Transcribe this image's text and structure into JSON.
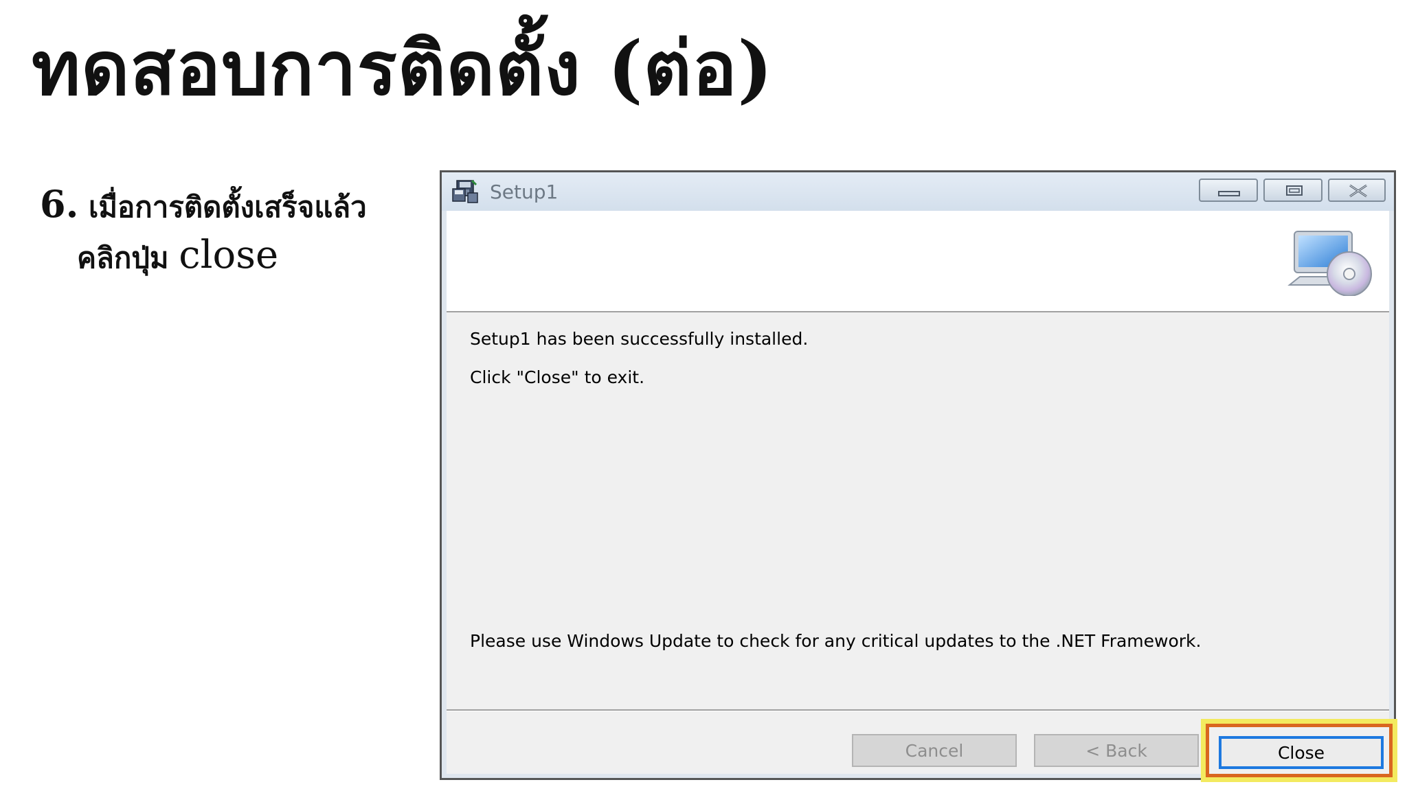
{
  "slide": {
    "title": "ทดสอบการติดตั้ง (ต่อ)",
    "step_number": "6.",
    "step_line1": "เมื่อการติดตั้งเสร็จแล้ว",
    "step_line2_thai": "คลิกปุ่ม",
    "step_line2_en": "close"
  },
  "window": {
    "title": "Setup1",
    "app_icon": "installer-floppy-icon",
    "controls": {
      "minimize_icon": "minimize-icon",
      "maximize_icon": "maximize-icon",
      "close_icon": "close-icon"
    },
    "banner_icon": "computer-cd-icon",
    "messages": {
      "line1": "Setup1 has been successfully installed.",
      "line2": "Click \"Close\" to exit.",
      "line3": "Please use Windows Update to check for any critical updates to the .NET Framework."
    },
    "buttons": {
      "cancel_label": "Cancel",
      "back_label": "< Back",
      "close_label": "Close"
    }
  },
  "colors": {
    "highlight_outer": "#f3ea5f",
    "highlight_inner": "#d9661f",
    "focus_border": "#1d79e0"
  }
}
